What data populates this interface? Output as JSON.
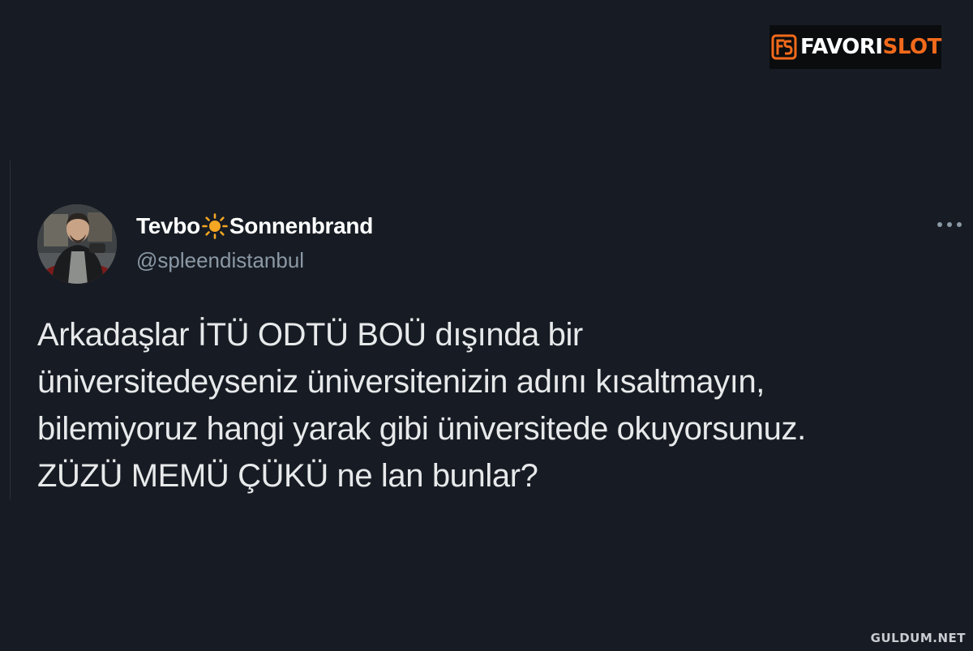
{
  "brand": {
    "logo_text_1": "FAVORI",
    "logo_text_2": "SLOT",
    "accent_color": "#f26a1b"
  },
  "tweet": {
    "display_name_before_emoji": "Tevbo",
    "display_name_emoji": "sun-icon",
    "display_name_after_emoji": "Sonnenbrand",
    "handle": "@spleendistanbul",
    "more_icon": "more-horizontal-icon",
    "text_lines": [
      "Arkadaşlar İTÜ ODTÜ BOÜ dışında bir",
      "üniversitedeyseniz üniversitenizin adını kısaltmayın,",
      "bilemiyoruz hangi yarak gibi üniversitede okuyorsunuz.",
      "ZÜZÜ MEMÜ ÇÜKÜ ne lan bunlar?"
    ]
  },
  "watermark": {
    "text": "GULDUM.NET"
  },
  "colors": {
    "background": "#171c24",
    "text_primary": "#e7e9ea",
    "text_secondary": "#8b98a5",
    "sun": "#f5a623"
  }
}
